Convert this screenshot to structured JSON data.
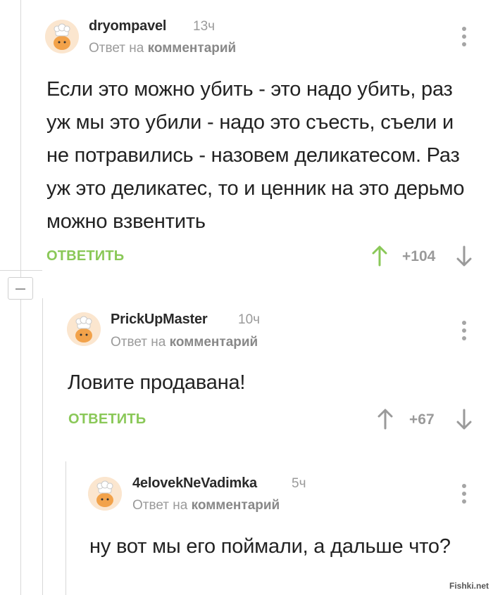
{
  "comments": [
    {
      "author": "dryompavel",
      "time": "13ч",
      "reply_prefix": "Ответ на",
      "reply_link": "комментарий",
      "text": "Если это можно убить - это надо убить, раз уж мы это убили - надо это съесть, съели и не потравились - назовем деликатесом. Раз уж это деликатес, то и ценник на это дерьмо можно взвентить",
      "reply_label": "ОТВЕТИТЬ",
      "score": "+104",
      "upvoted": true
    },
    {
      "author": "PrickUpMaster",
      "time": "10ч",
      "reply_prefix": "Ответ на",
      "reply_link": "комментарий",
      "text": "Ловите продавана!",
      "reply_label": "ОТВЕТИТЬ",
      "score": "+67",
      "upvoted": false
    },
    {
      "author": "4elovekNeVadimka",
      "time": "5ч",
      "reply_prefix": "Ответ на",
      "reply_link": "комментарий",
      "text": "ну вот мы его поймали, а дальше что?"
    }
  ],
  "watermark": "Fishki.net",
  "colors": {
    "accent": "#8ac858",
    "muted": "#9a9a9a",
    "line": "#d8d8d8"
  }
}
